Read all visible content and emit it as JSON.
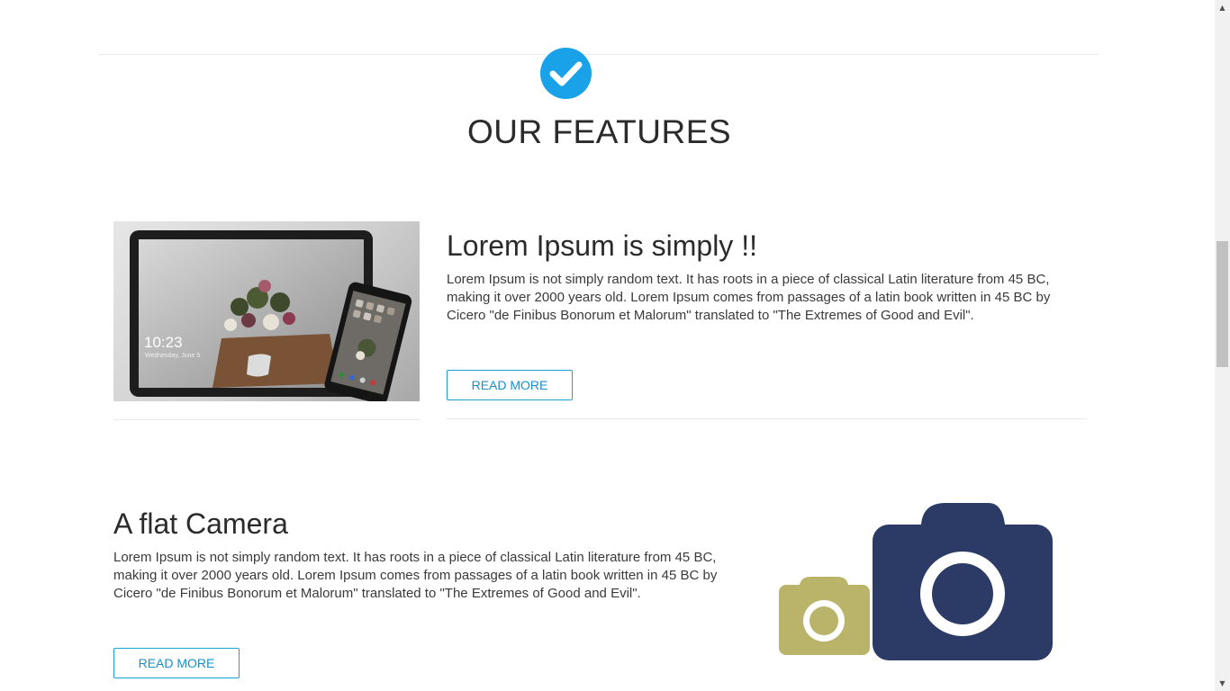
{
  "header": {
    "title": "OUR FEATURES",
    "badge_icon": "check-circle-icon",
    "accent_color": "#1aa2e8"
  },
  "features": [
    {
      "heading": "Lorem Ipsum is simply !!",
      "text": "Lorem Ipsum is not simply random text. It has roots in a piece of classical Latin literature from 45 BC, making it over 2000 years old. Lorem Ipsum comes from passages of a latin book written in 45 BC by Cicero \"de Finibus Bonorum et Malorum\" translated to \"The Extremes of Good and Evil\".",
      "button_label": "READ MORE",
      "image": {
        "icon": "tablet-phone-photo",
        "clock_time": "10:23",
        "clock_date": "Wednesday, June 5"
      }
    },
    {
      "heading": "A flat Camera",
      "text": "Lorem Ipsum is not simply random text. It has roots in a piece of classical Latin literature from 45 BC, making it over 2000 years old. Lorem Ipsum comes from passages of a latin book written in 45 BC by Cicero \"de Finibus Bonorum et Malorum\" translated to \"The Extremes of Good and Evil\".",
      "button_label": "READ MORE",
      "image": {
        "icon": "camera-icon",
        "colors": {
          "large": "#2b3b66",
          "small": "#b9b46a"
        }
      }
    }
  ],
  "scrollbar": {
    "up_arrow_icon": "scroll-up-arrow-icon",
    "down_arrow_icon": "scroll-down-arrow-icon"
  }
}
